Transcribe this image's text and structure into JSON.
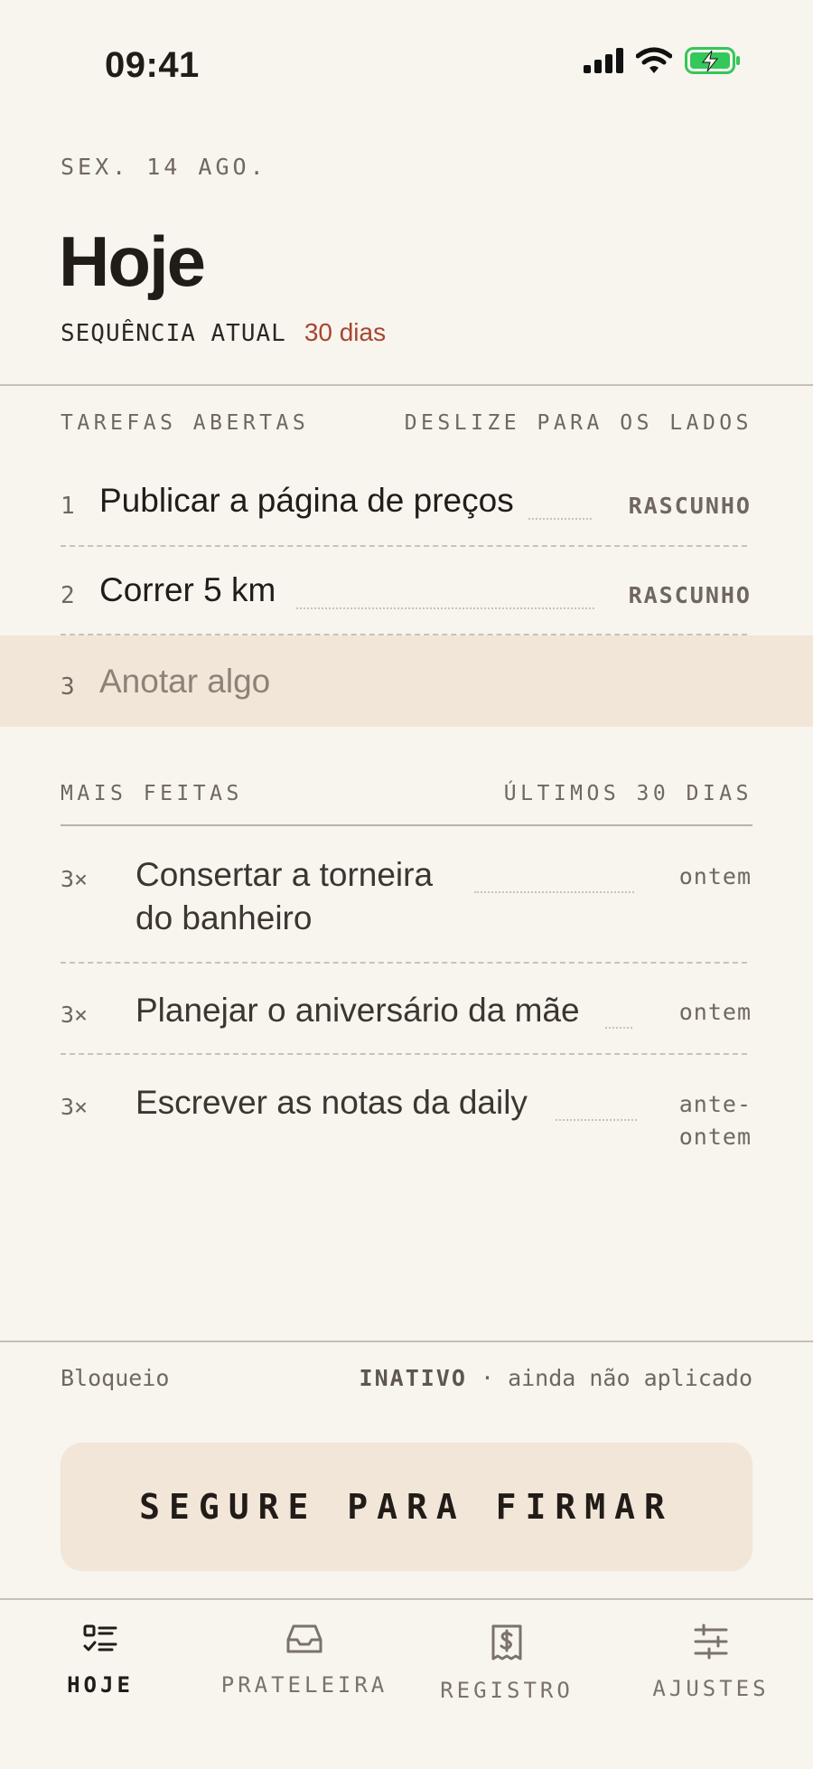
{
  "status_bar": {
    "time": "09:41"
  },
  "header": {
    "date": "SEX. 14 AGO.",
    "title": "Hoje",
    "streak_label": "SEQUÊNCIA ATUAL",
    "streak_value": "30 dias"
  },
  "open_tasks": {
    "heading": "TAREFAS ABERTAS",
    "hint": "DESLIZE PARA OS LADOS",
    "items": [
      {
        "num": "1",
        "text": "Publicar a página de preços",
        "tag": "RASCUNHO"
      },
      {
        "num": "2",
        "text": "Correr 5 km",
        "tag": "RASCUNHO"
      }
    ],
    "new_item": {
      "num": "3",
      "placeholder": "Anotar algo"
    }
  },
  "most_done": {
    "heading": "MAIS FEITAS",
    "range": "ÚLTIMOS 30 DIAS",
    "items": [
      {
        "count": "3×",
        "text": "Consertar a torneira do banheiro",
        "line1": "Consertar a torneira",
        "line2": "do banheiro",
        "when": "ontem"
      },
      {
        "count": "3×",
        "text": "Planejar o aniversário da mãe",
        "when": "ontem"
      },
      {
        "count": "3×",
        "text": "Escrever as notas da daily",
        "when1": "ante-",
        "when2": "ontem"
      }
    ]
  },
  "block": {
    "label": "Bloqueio",
    "state": "INATIVO",
    "detail": "· ainda não aplicado"
  },
  "hold_button": {
    "label": "SEGURE PARA FIRMAR"
  },
  "tabs": [
    {
      "label": "HOJE",
      "icon": "checklist-icon",
      "active": true
    },
    {
      "label": "PRATELEIRA",
      "icon": "inbox-tray-icon",
      "active": false
    },
    {
      "label": "REGISTRO",
      "icon": "receipt-dollar-icon",
      "active": false
    },
    {
      "label": "AJUSTES",
      "icon": "sliders-icon",
      "active": false
    }
  ],
  "colors": {
    "background": "#f8f4ee",
    "accent": "#a8452e",
    "highlight": "#f2e6d8",
    "battery": "#34c759"
  }
}
